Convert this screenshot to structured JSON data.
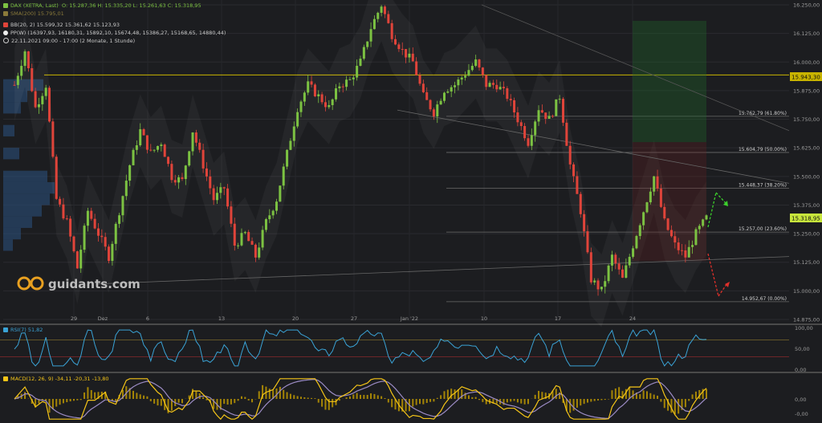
{
  "header": {
    "instrument": "DAX (XETRA, Last)",
    "ohlc": "O: 15.287,36  H: 15.335,20  L: 15.261,63  C: 15.318,95",
    "sma": "SMA(200)  15.795,01",
    "bb": "BB(20, 2)  15.599,32  15.361,62  15.123,93",
    "pp": "PP(W)  (16397,93, 16180,31, 15892,10, 15674,48, 15386,27, 15168,65, 14880,44)",
    "period": "22.11.2021 09:00 - 17:00  (2 Monate, 1 Stunde)"
  },
  "watermark": "guidants.com",
  "colors": {
    "background": "#1c1d20",
    "up": "#7cc242",
    "down": "#e0443a",
    "price_label": "#c8e63c",
    "level_line": "#c8b400",
    "rsi": "#3aa3d6",
    "macd": "#f5c518",
    "signal": "#9b8bc4",
    "histogram": "#c8a000"
  },
  "chart_data": [
    {
      "type": "candlestick",
      "ylim": [
        14875,
        16250
      ],
      "y_ticks": [
        "16.250,00",
        "16.125,00",
        "16.000,00",
        "15.875,00",
        "15.750,00",
        "15.625,00",
        "15.500,00",
        "15.375,00",
        "15.250,00",
        "15.125,00",
        "15.000,00",
        "14.875,00"
      ],
      "x_labels": [
        "29",
        "Dez",
        "6",
        "13",
        "20",
        "27",
        "Jan '22",
        "10",
        "17",
        "24"
      ],
      "current_price": "15.318,95",
      "horizontal_level": "15.943,30",
      "fibonacci": [
        "15.762,79 (61.80%)",
        "15.604,79 (50.00%)",
        "15.448,37 (38.20%)",
        "15.257,00 (23.60%)",
        "14.952,67 (0.00%)"
      ],
      "close_path": [
        [
          0,
          15900
        ],
        [
          3,
          16050
        ],
        [
          6,
          15800
        ],
        [
          9,
          15900
        ],
        [
          12,
          15400
        ],
        [
          15,
          15300
        ],
        [
          18,
          15100
        ],
        [
          21,
          15350
        ],
        [
          24,
          15250
        ],
        [
          27,
          15150
        ],
        [
          30,
          15350
        ],
        [
          33,
          15550
        ],
        [
          36,
          15700
        ],
        [
          39,
          15600
        ],
        [
          42,
          15650
        ],
        [
          45,
          15500
        ],
        [
          48,
          15480
        ],
        [
          51,
          15700
        ],
        [
          54,
          15550
        ],
        [
          57,
          15400
        ],
        [
          60,
          15450
        ],
        [
          63,
          15200
        ],
        [
          66,
          15250
        ],
        [
          69,
          15150
        ],
        [
          72,
          15300
        ],
        [
          75,
          15400
        ],
        [
          78,
          15600
        ],
        [
          81,
          15800
        ],
        [
          84,
          15900
        ],
        [
          87,
          15850
        ],
        [
          90,
          15800
        ],
        [
          93,
          15900
        ],
        [
          96,
          15920
        ],
        [
          99,
          16000
        ],
        [
          102,
          16150
        ],
        [
          105,
          16250
        ],
        [
          108,
          16120
        ],
        [
          111,
          16050
        ],
        [
          114,
          16000
        ],
        [
          117,
          15850
        ],
        [
          120,
          15780
        ],
        [
          123,
          15880
        ],
        [
          126,
          15900
        ],
        [
          129,
          15950
        ],
        [
          132,
          16000
        ],
        [
          135,
          15900
        ],
        [
          138,
          15900
        ],
        [
          141,
          15850
        ],
        [
          144,
          15750
        ],
        [
          147,
          15650
        ],
        [
          150,
          15800
        ],
        [
          153,
          15750
        ],
        [
          156,
          15850
        ],
        [
          159,
          15550
        ],
        [
          162,
          15350
        ],
        [
          165,
          15050
        ],
        [
          168,
          15000
        ],
        [
          171,
          15150
        ],
        [
          174,
          15050
        ],
        [
          177,
          15200
        ],
        [
          180,
          15350
        ],
        [
          183,
          15500
        ],
        [
          186,
          15300
        ],
        [
          189,
          15200
        ],
        [
          192,
          15150
        ],
        [
          195,
          15250
        ],
        [
          198,
          15318
        ]
      ]
    },
    {
      "type": "line",
      "indicator": "RSI(7)  51,82",
      "ylim": [
        0,
        100
      ],
      "y_ticks": [
        "100,00",
        "50,00",
        "0,00"
      ],
      "levels": [
        70,
        30
      ]
    },
    {
      "type": "bar",
      "indicator": "MACD(12, 26, 9)  -34,11  -20,31  -13,80",
      "ylim": [
        -150,
        150
      ],
      "y_ticks": [
        "0,00",
        "-0,00"
      ]
    }
  ]
}
